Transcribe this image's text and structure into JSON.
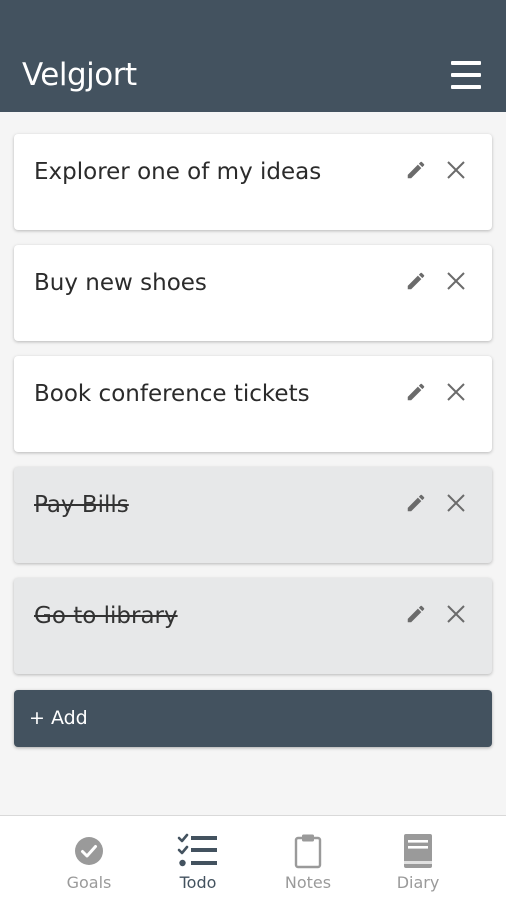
{
  "header": {
    "title": "Velgjort",
    "menu_icon": "hamburger-menu-icon"
  },
  "todos": [
    {
      "text": "Explorer one of my ideas",
      "done": false
    },
    {
      "text": "Buy new shoes",
      "done": false
    },
    {
      "text": "Book conference tickets",
      "done": false
    },
    {
      "text": "Pay Bills",
      "done": true
    },
    {
      "text": "Go to library",
      "done": true
    }
  ],
  "add_button": {
    "label": "+ Add"
  },
  "bottom_nav": {
    "active": "Todo",
    "items": [
      {
        "label": "Goals",
        "icon": "check-circle-icon"
      },
      {
        "label": "Todo",
        "icon": "checklist-icon"
      },
      {
        "label": "Notes",
        "icon": "clipboard-icon"
      },
      {
        "label": "Diary",
        "icon": "book-icon"
      }
    ]
  },
  "colors": {
    "primary": "#43525f",
    "background": "#f5f5f5",
    "card": "#ffffff",
    "card_done": "#e7e8e9",
    "nav_inactive": "#9a9a9a"
  }
}
